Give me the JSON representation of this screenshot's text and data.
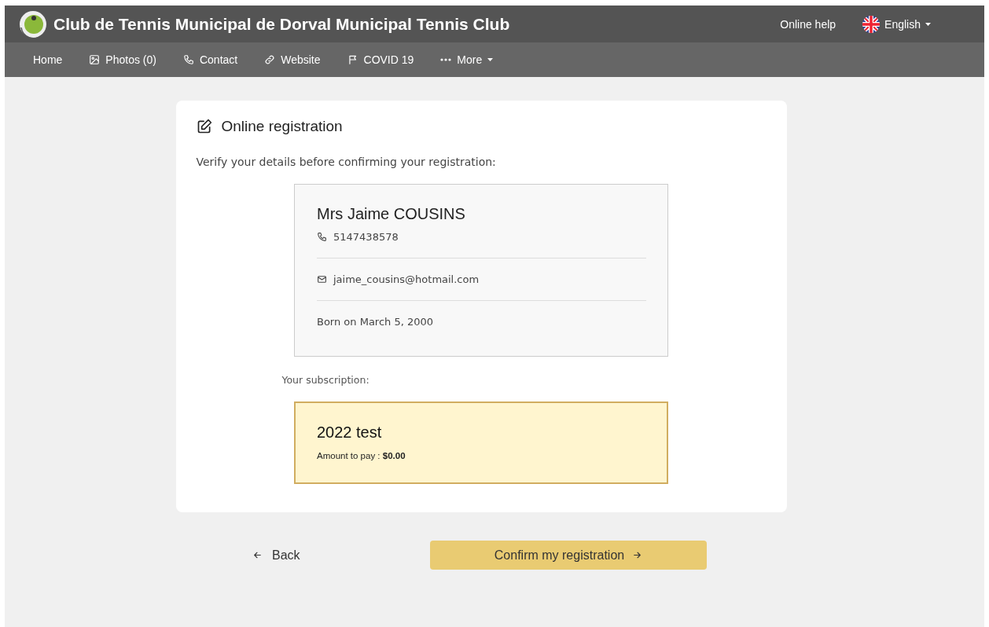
{
  "header": {
    "title": "Club de Tennis Municipal de Dorval Municipal Tennis Club",
    "help_link": "Online help",
    "language": "English"
  },
  "nav": [
    {
      "label": "Home"
    },
    {
      "label": "Photos (0)"
    },
    {
      "label": "Contact"
    },
    {
      "label": "Website"
    },
    {
      "label": "COVID 19"
    },
    {
      "label": "More"
    }
  ],
  "card": {
    "title": "Online registration",
    "intro": "Verify your details before confirming your registration:",
    "person": {
      "name": "Mrs Jaime COUSINS",
      "phone": "5147438578",
      "email": "jaime_cousins@hotmail.com",
      "birth": "Born on March 5, 2000"
    },
    "subscription_label": "Your subscription:",
    "subscription": {
      "name": "2022 test",
      "amount": "Amount to pay : **$0.00**"
    }
  },
  "actions": {
    "back": "Back",
    "confirm": "Confirm my registration"
  }
}
